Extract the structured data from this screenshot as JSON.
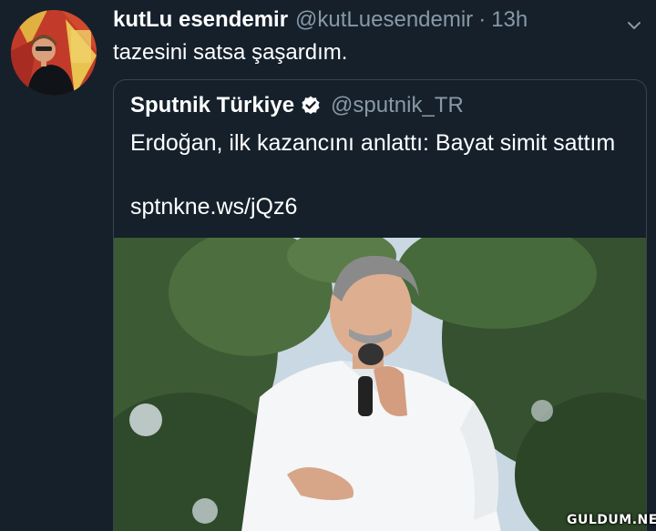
{
  "tweet": {
    "author_name": "kutLu esendemir",
    "author_handle": "@kutLuesendemir",
    "separator": "·",
    "time": "13h",
    "text": "tazesini satsa şaşardım.",
    "menu_icon": "chevron-down-icon"
  },
  "quoted_tweet": {
    "author_name": "Sputnik Türkiye",
    "verified_icon": "verified-badge-icon",
    "author_handle": "@sputnik_TR",
    "text": "Erdoğan, ilk kazancını anlattı: Bayat simit sattım",
    "link": "sptnkne.ws/jQz6"
  },
  "watermark": "GULDUM.NET",
  "colors": {
    "background": "#15202b",
    "secondary_text": "#8899a6",
    "border": "#38444d",
    "verified_badge": "#ffffff"
  }
}
